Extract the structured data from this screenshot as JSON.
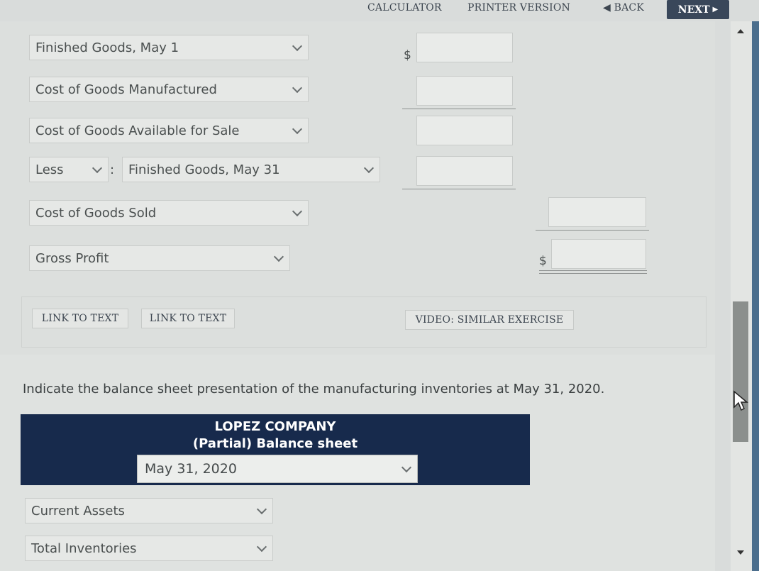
{
  "toolbar": {
    "calculator": "CALCULATOR",
    "printer_version": "PRINTER VERSION",
    "back": "BACK",
    "next": "NEXT"
  },
  "schedule": {
    "rows": [
      {
        "label": "Finished Goods, May 1",
        "dollar": "$"
      },
      {
        "label": "Cost of Goods Manufactured"
      },
      {
        "label": "Cost of Goods Available for Sale"
      },
      {
        "less_label": "Less",
        "colon": ":",
        "label": "Finished Goods, May 31"
      },
      {
        "label": "Cost of Goods Sold"
      },
      {
        "label": "Gross Profit",
        "dollar": "$"
      }
    ]
  },
  "links": {
    "link_to_text_1": "LINK TO TEXT",
    "link_to_text_2": "LINK TO TEXT",
    "video": "VIDEO: SIMILAR EXERCISE"
  },
  "question": "Indicate the balance sheet presentation of the manufacturing inventories at May 31, 2020.",
  "balance_sheet": {
    "company": "LOPEZ COMPANY",
    "subtitle": "(Partial) Balance sheet",
    "date": "May 31, 2020",
    "rows": [
      "Current Assets",
      "Total Inventories"
    ]
  },
  "colors": {
    "header_bg": "#172a4c",
    "next_bg": "#39475a"
  }
}
